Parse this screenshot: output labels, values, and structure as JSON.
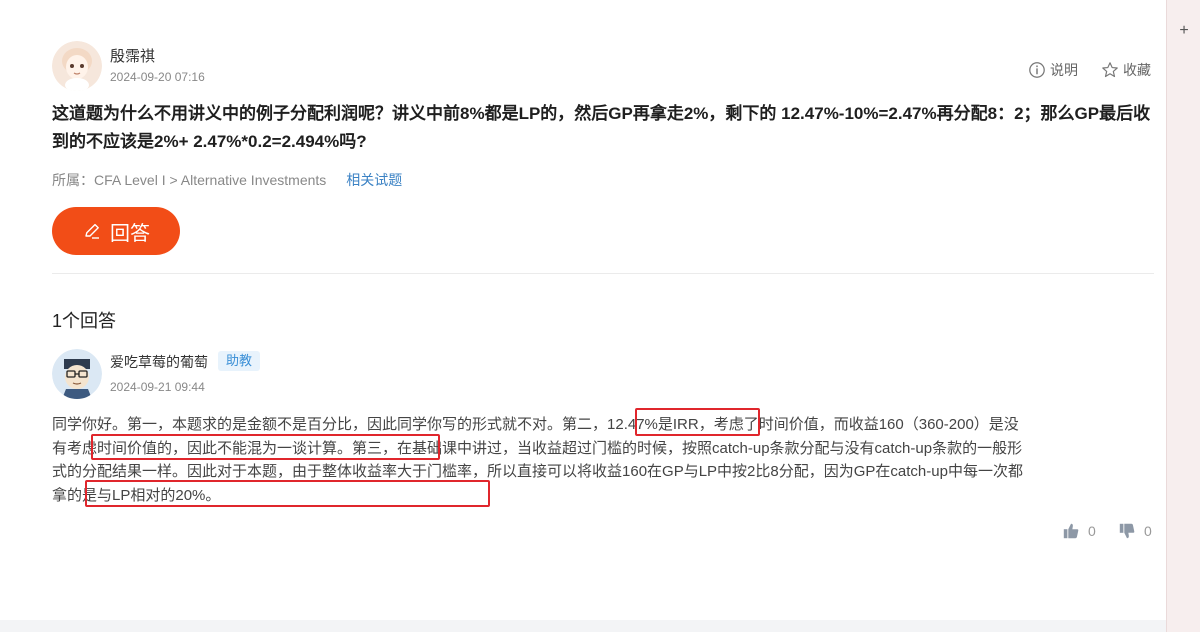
{
  "question": {
    "author": "殷霈祺",
    "time": "2024-09-20 07:16",
    "explain_label": "说明",
    "favorite_label": "收藏",
    "title": "这道题为什么不用讲义中的例子分配利润呢？讲义中前8%都是LP的，然后GP再拿走2%，剩下的 12.47%-10%=2.47%再分配8：2；那么GP最后收到的不应该是2%+ 2.47%*0.2=2.494%吗?",
    "category": "所属：CFA Level I > Alternative Investments",
    "related_label": "相关试题",
    "answer_button": "回答"
  },
  "answers": {
    "count_label": "1个回答",
    "items": [
      {
        "author": "爱吃草莓的葡萄",
        "badge": "助教",
        "time": "2024-09-21 09:44",
        "body": "同学你好。第一，本题求的是金额不是百分比，因此同学你写的形式就不对。第二，12.47%是IRR，考虑了时间价值，而收益160（360-200）是没有考虑时间价值的，因此不能混为一谈计算。第三，在基础课中讲过，当收益超过门槛的时候，按照catch-up条款分配与没有catch-up条款的一般形式的分配结果一样。因此对于本题，由于整体收益率大于门槛率，所以直接可以将收益160在GP与LP中按2比8分配，因为GP在catch-up中每一次都拿的是与LP相对的20%。",
        "likes": "0",
        "dislikes": "0"
      }
    ]
  },
  "side": {
    "plus_label": "+"
  },
  "colors": {
    "accent": "#f24d17",
    "link": "#3b82c4",
    "highlight": "#e0262c",
    "badge_bg": "#e8f3fc"
  }
}
